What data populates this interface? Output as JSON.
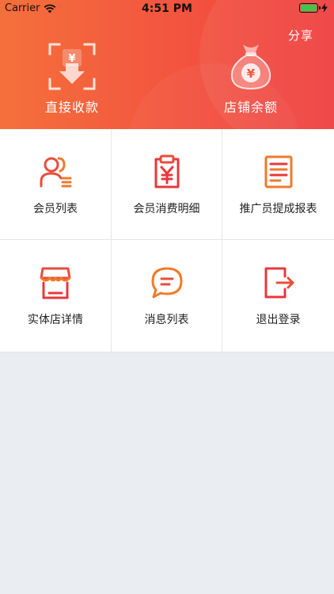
{
  "status_bar": {
    "carrier": "Carrier",
    "time": "4:51 PM"
  },
  "header": {
    "share_label": "分享",
    "actions": [
      {
        "label": "直接收款",
        "icon": "scan-yen-icon"
      },
      {
        "label": "店铺余额",
        "icon": "money-bag-icon"
      }
    ]
  },
  "menu": {
    "items": [
      {
        "label": "会员列表",
        "icon": "members-list-icon"
      },
      {
        "label": "会员消费明细",
        "icon": "clipboard-yen-icon"
      },
      {
        "label": "推广员提成报表",
        "icon": "report-icon"
      },
      {
        "label": "实体店详情",
        "icon": "store-icon"
      },
      {
        "label": "消息列表",
        "icon": "message-bubble-icon"
      },
      {
        "label": "退出登录",
        "icon": "logout-icon"
      }
    ]
  },
  "colors": {
    "header_gradient_start": "#f4703b",
    "header_gradient_end": "#ef3e3e",
    "icon_orange": "#f07a2a",
    "icon_red": "#e8383d",
    "page_background": "#eaedf1"
  }
}
